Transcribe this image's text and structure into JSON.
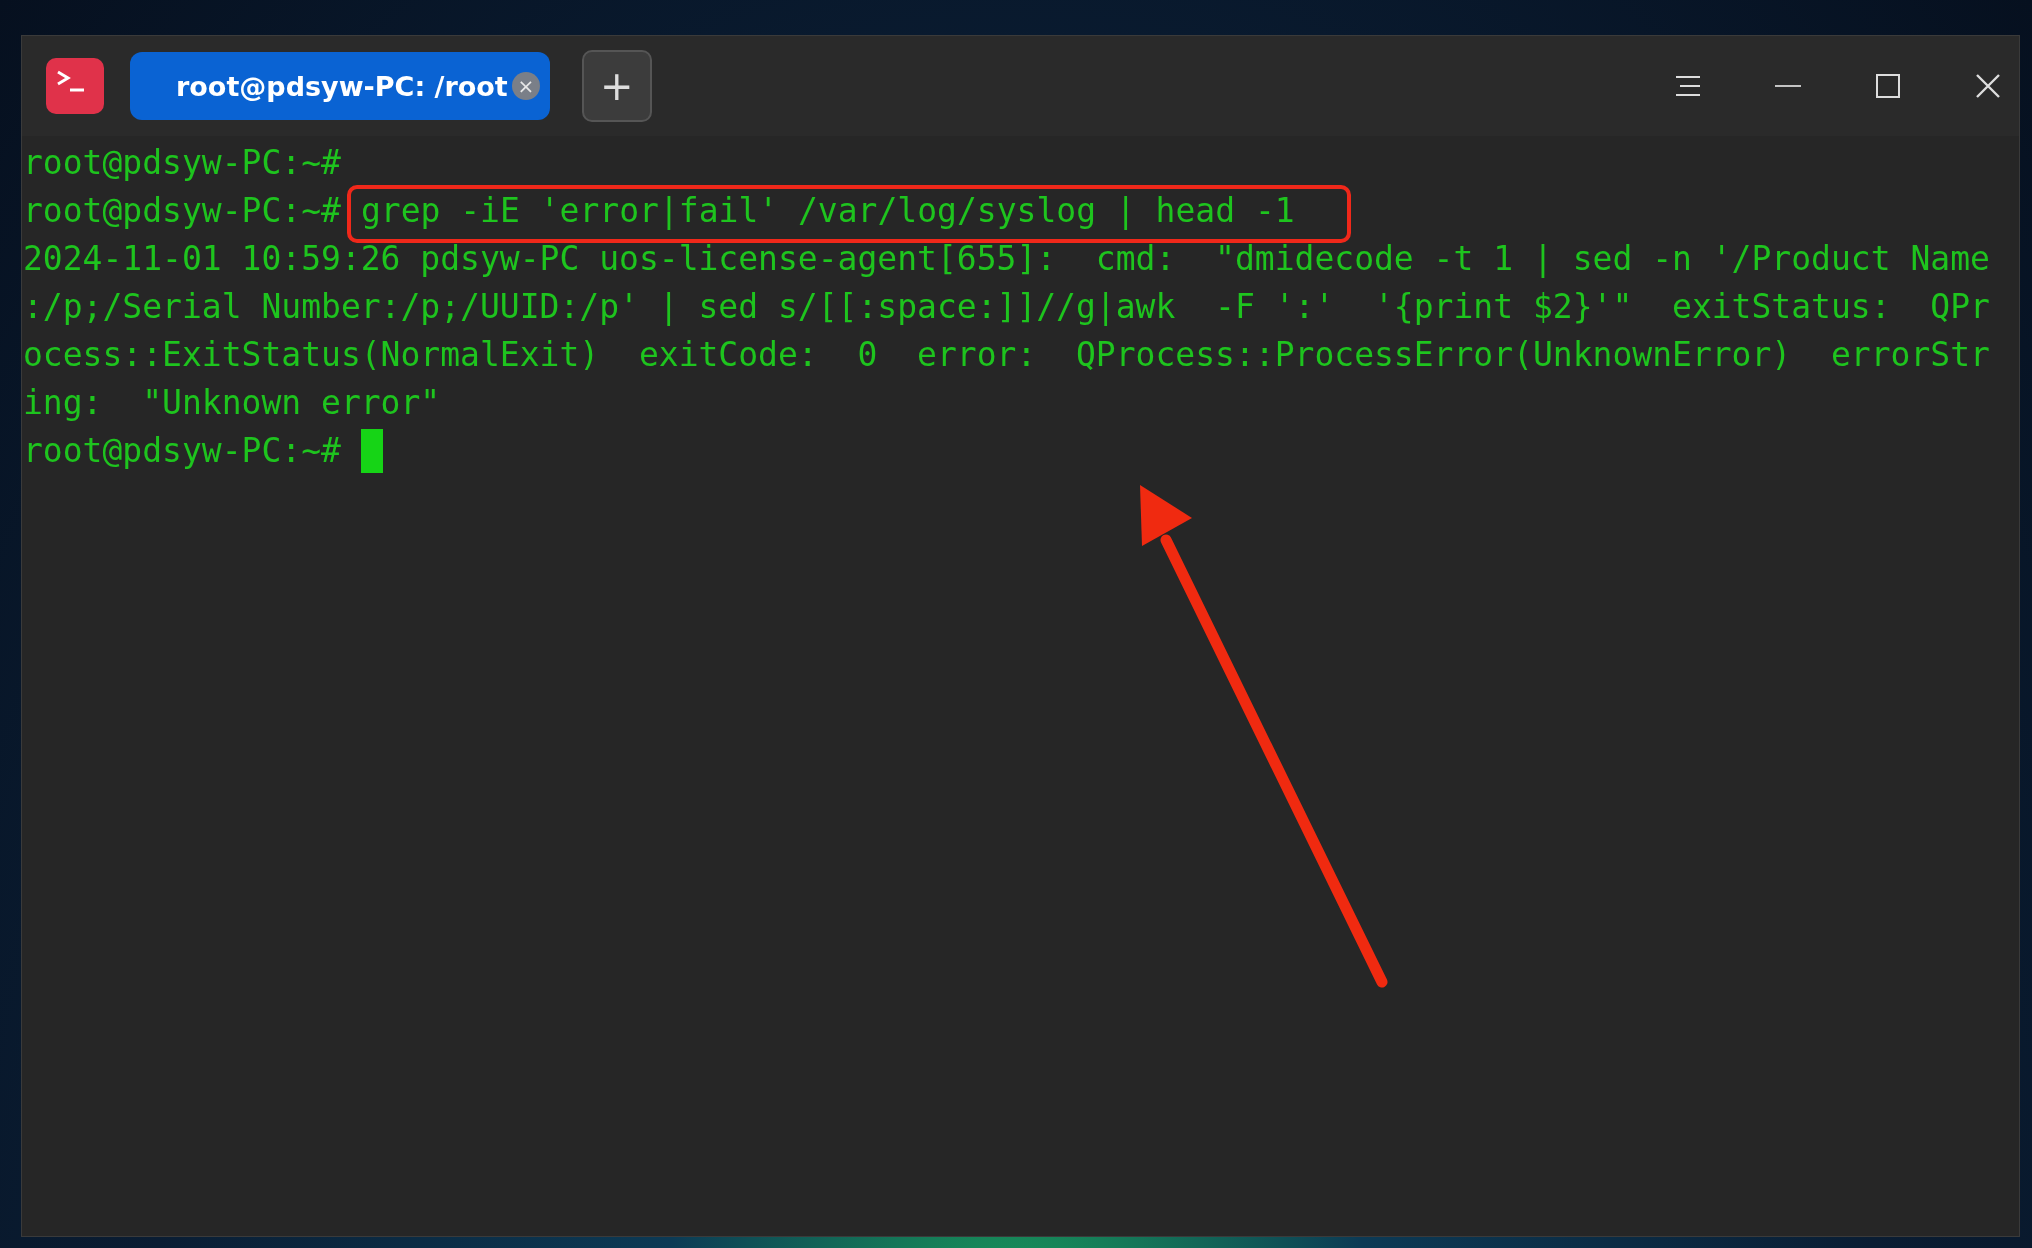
{
  "tabs": [
    {
      "label": "root@pdsyw-PC: /root",
      "selected": true,
      "close_glyph": "×"
    }
  ],
  "new_tab_button": "+",
  "terminal": {
    "lines": [
      {
        "kind": "prompt",
        "prompt": "root@pdsyw-PC:~#"
      },
      {
        "kind": "prompt",
        "prompt": "root@pdsyw-PC:~#",
        "command": "grep -iE 'error|fail' /var/log/syslog | head -1",
        "highlighted": true
      },
      {
        "kind": "output",
        "text": "2024-11-01 10:59:26 pdsyw-PC uos-license-agent[655]:  cmd:  \"dmidecode -t 1 | sed -n '/Product Name"
      },
      {
        "kind": "output",
        "text": ":/p;/Serial Number:/p;/UUID:/p' | sed s/[[:space:]]//g|awk  -F ':'  '{print $2}'\"  exitStatus:  QPr"
      },
      {
        "kind": "output",
        "text": "ocess::ExitStatus(NormalExit)  exitCode:  0  error:  QProcess::ProcessError(UnknownError)  errorStr"
      },
      {
        "kind": "output",
        "text": "ing:  \"Unknown error\""
      },
      {
        "kind": "prompt",
        "prompt": "root@pdsyw-PC:~#",
        "cursor": true
      }
    ]
  },
  "annotation_arrow": true
}
